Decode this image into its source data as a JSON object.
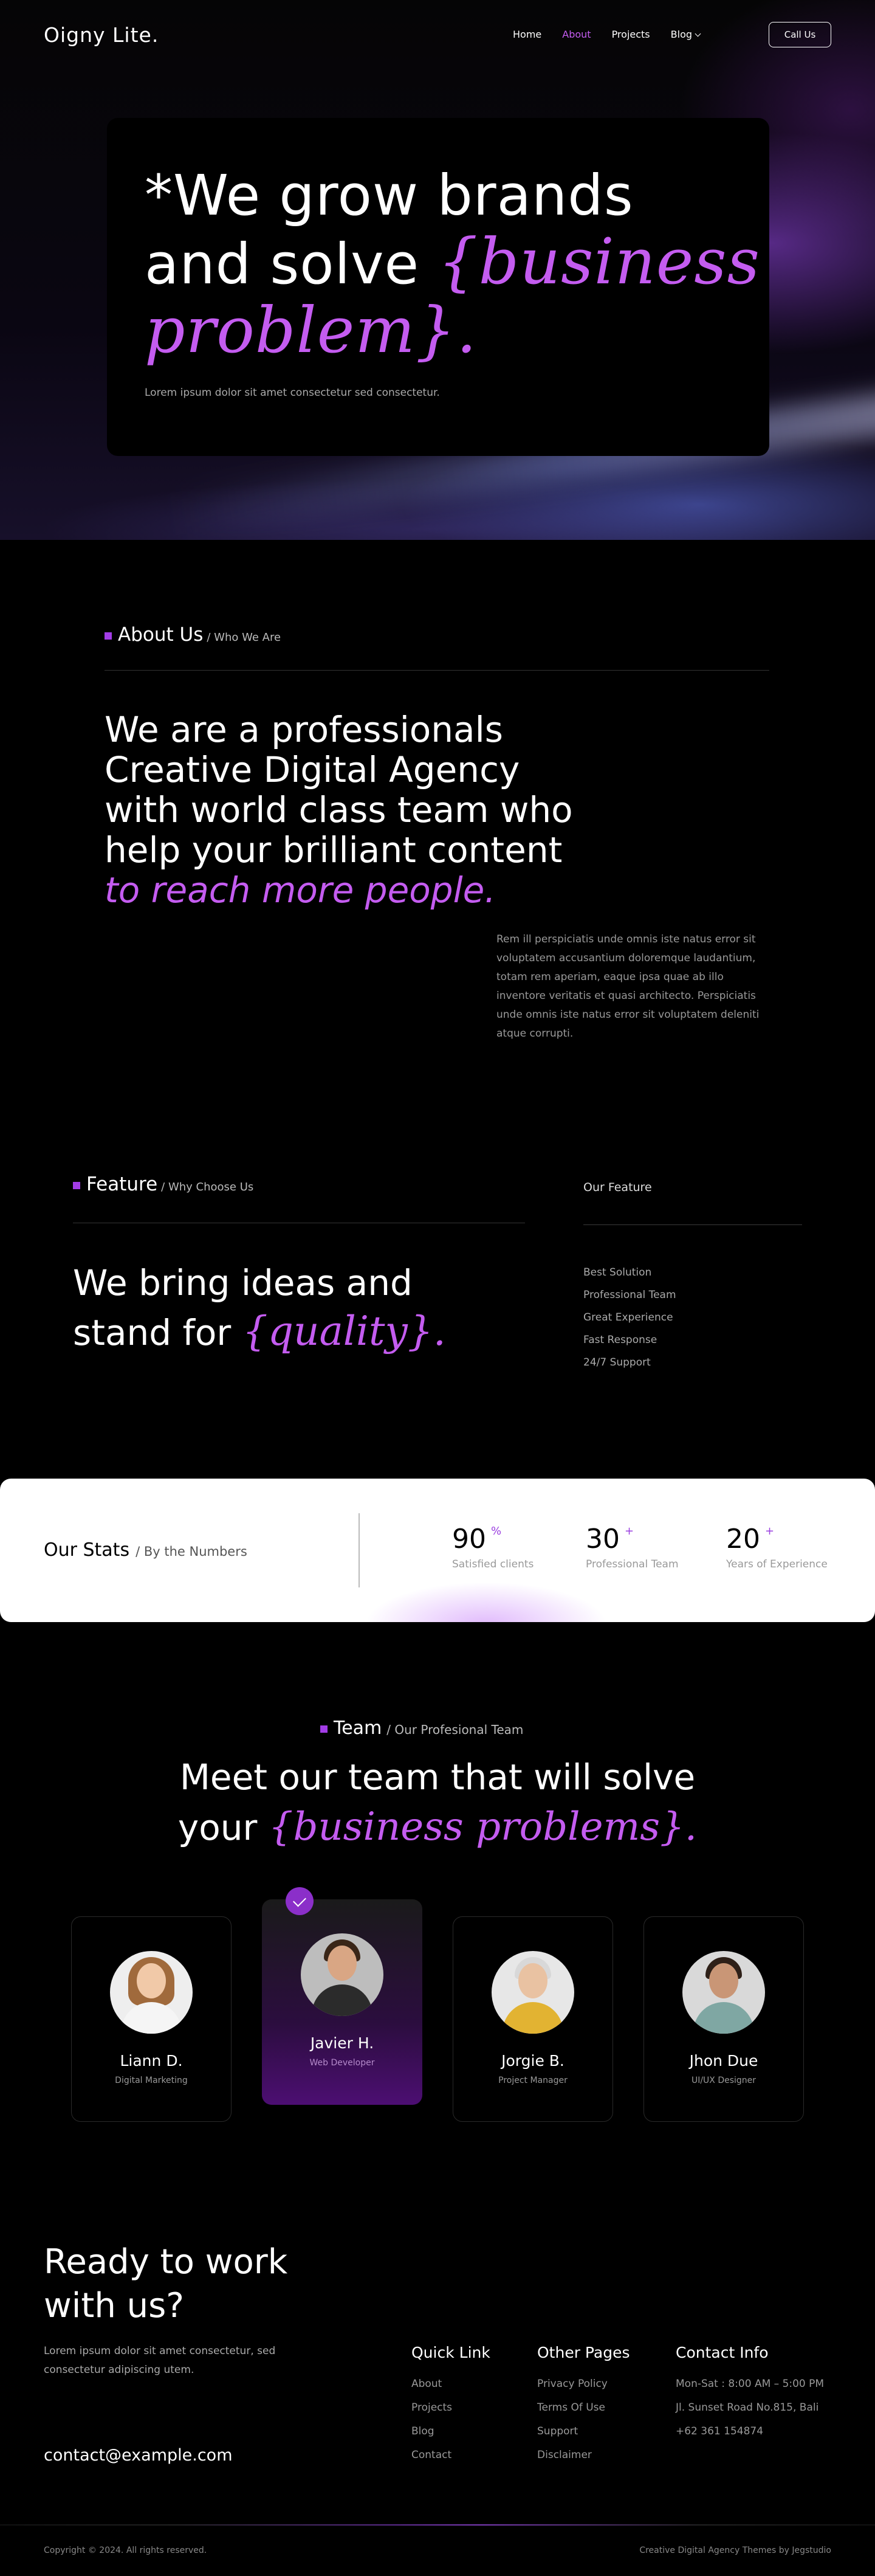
{
  "nav": {
    "logo": "Oigny Lite.",
    "items": [
      "Home",
      "About",
      "Projects",
      "Blog"
    ],
    "active": "About",
    "cta": "Call Us"
  },
  "hero": {
    "title_line1": "*We grow brands",
    "title_line2_plain": "and solve ",
    "title_line2_italic": "{business",
    "title_line3_italic": "problem}.",
    "subtitle": "Lorem ipsum dolor sit amet consectetur sed consectetur."
  },
  "about": {
    "label": "About Us",
    "sublabel": "/ Who We Are",
    "headline_lines": [
      "We are a professionals",
      "Creative Digital Agency",
      "with world class team who",
      "help your brilliant content"
    ],
    "headline_accent": "to reach more people.",
    "body": "Rem ill perspiciatis unde omnis iste natus error sit voluptatem accusantium doloremque laudantium, totam rem aperiam, eaque ipsa quae ab illo inventore veritatis et quasi architecto. Perspiciatis unde omnis iste natus error sit voluptatem deleniti atque corrupti."
  },
  "feature": {
    "label": "Feature",
    "sublabel": "/ Why Choose Us",
    "headline_line1": "We bring ideas and",
    "headline_line2_plain": "stand for ",
    "headline_line2_italic": "{quality}.",
    "list_title": "Our Feature",
    "list": [
      "Best Solution",
      "Professional Team",
      "Great Experience",
      "Fast Response",
      "24/7 Support"
    ]
  },
  "stats": {
    "title": "Our Stats",
    "subtitle": "/ By the Numbers",
    "items": [
      {
        "value": "90",
        "suffix": "%",
        "label": "Satisfied clients"
      },
      {
        "value": "30",
        "suffix": "+",
        "label": "Professional Team"
      },
      {
        "value": "20",
        "suffix": "+",
        "label": "Years of Experience"
      }
    ]
  },
  "team": {
    "label": "Team",
    "sublabel": "/ Our Profesional Team",
    "headline_line1": "Meet our team that will solve",
    "headline_line2_plain": "your ",
    "headline_line2_italic": "{business problems}.",
    "members": [
      {
        "name": "Liann D.",
        "role": "Digital Marketing"
      },
      {
        "name": "Javier H.",
        "role": "Web Developer"
      },
      {
        "name": "Jorgie B.",
        "role": "Project Manager"
      },
      {
        "name": "Jhon Due",
        "role": "UI/UX Designer"
      }
    ]
  },
  "footer": {
    "cta_line1": "Ready to work",
    "cta_line2": "with us?",
    "cta_sub": "Lorem ipsum dolor sit amet consectetur, sed consectetur adipiscing utem.",
    "email": "contact@example.com",
    "quick_link_title": "Quick Link",
    "quick_links": [
      "About",
      "Projects",
      "Blog",
      "Contact"
    ],
    "other_pages_title": "Other Pages",
    "other_pages": [
      "Privacy Policy",
      "Terms Of Use",
      "Support",
      "Disclaimer"
    ],
    "contact_title": "Contact Info",
    "contact": [
      "Mon-Sat : 8:00 AM – 5:00 PM",
      "Jl. Sunset Road No.815, Bali",
      "+62 361 154874"
    ],
    "copyright": "Copyright © 2024. All rights reserved.",
    "credit": "Creative Digital Agency Themes by Jegstudio"
  },
  "colors": {
    "accent": "#c45cf0",
    "accent_dark": "#8b2fc9",
    "background": "#000000"
  }
}
